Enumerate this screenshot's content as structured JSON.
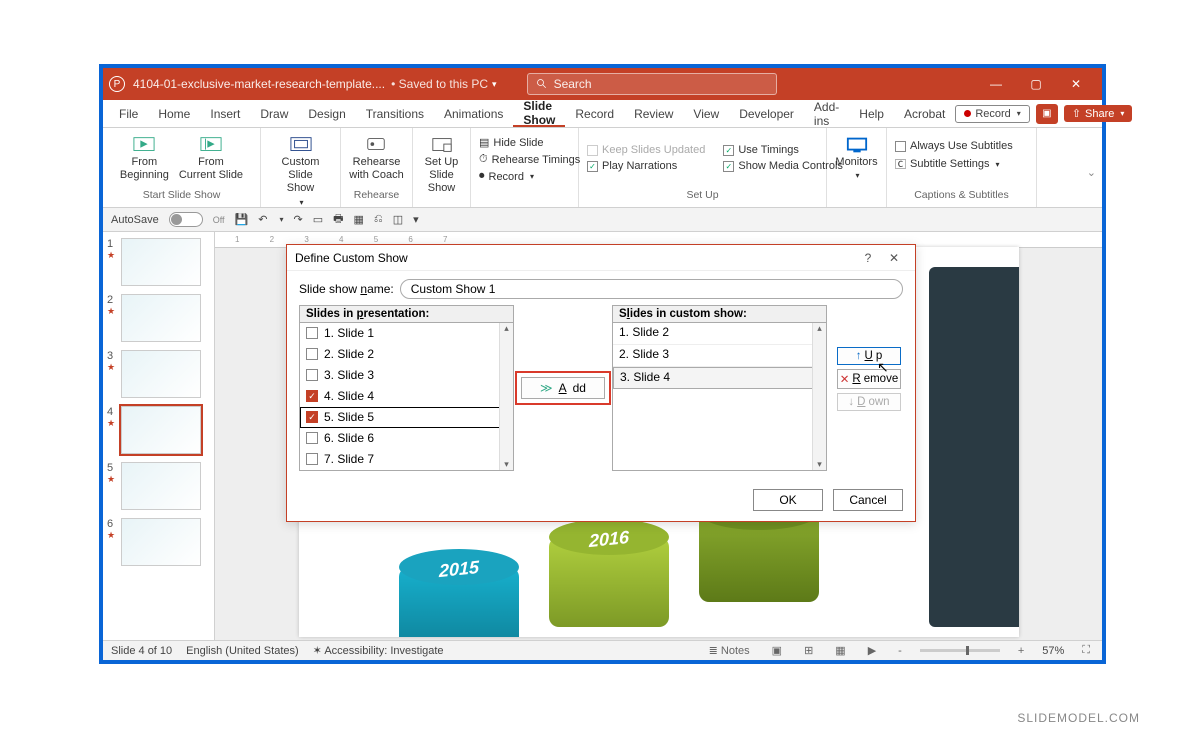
{
  "titlebar": {
    "filename": "4104-01-exclusive-market-research-template....",
    "saved_status": "Saved to this PC",
    "search_placeholder": "Search"
  },
  "window_controls": {
    "minimize": "—",
    "maximize": "▢",
    "close": "✕"
  },
  "menu": {
    "tabs": [
      "File",
      "Home",
      "Insert",
      "Draw",
      "Design",
      "Transitions",
      "Animations",
      "Slide Show",
      "Record",
      "Review",
      "View",
      "Developer",
      "Add-ins",
      "Help",
      "Acrobat"
    ],
    "active": "Slide Show",
    "record_button": "Record",
    "share_button": "Share"
  },
  "ribbon": {
    "start": {
      "from_beginning": "From\nBeginning",
      "from_current": "From\nCurrent Slide",
      "custom": "Custom Slide\nShow",
      "group": "Start Slide Show"
    },
    "rehearse": {
      "coach": "Rehearse\nwith Coach",
      "group": "Rehearse"
    },
    "setup": {
      "setup_show": "Set Up\nSlide Show",
      "hide_slide": "Hide Slide",
      "rehearse_timings": "Rehearse Timings",
      "record": "Record",
      "keep_updated": "Keep Slides Updated",
      "play_narrations": "Play Narrations",
      "use_timings": "Use Timings",
      "show_media": "Show Media Controls",
      "group": "Set Up"
    },
    "monitors": {
      "monitors": "Monitors"
    },
    "captions": {
      "always": "Always Use Subtitles",
      "settings": "Subtitle Settings",
      "group": "Captions & Subtitles"
    }
  },
  "qat": {
    "autosave": "AutoSave",
    "off": "Off"
  },
  "thumbs": [
    {
      "num": "1"
    },
    {
      "num": "2"
    },
    {
      "num": "3"
    },
    {
      "num": "4"
    },
    {
      "num": "5"
    },
    {
      "num": "6"
    }
  ],
  "canvas": {
    "year1": "2015",
    "year2": "2016"
  },
  "dialog": {
    "title": "Define Custom Show",
    "name_label": "Slide show name:",
    "name_value": "Custom Show 1",
    "left_header": "Slides in presentation:",
    "right_header": "Slides in custom show:",
    "left_items": [
      "1. Slide 1",
      "2. Slide 2",
      "3. Slide 3",
      "4. Slide 4",
      "5. Slide 5",
      "6. Slide 6",
      "7. Slide 7"
    ],
    "right_items": [
      "1. Slide 2",
      "2. Slide 3",
      "3. Slide 4"
    ],
    "add": "Add",
    "up": "Up",
    "remove": "Remove",
    "down": "Down",
    "ok": "OK",
    "cancel": "Cancel",
    "help": "?",
    "close": "✕"
  },
  "status": {
    "slide": "Slide 4 of 10",
    "lang": "English (United States)",
    "access": "Accessibility: Investigate",
    "notes": "Notes",
    "zoom": "57%"
  },
  "watermark": "SLIDEMODEL.COM"
}
